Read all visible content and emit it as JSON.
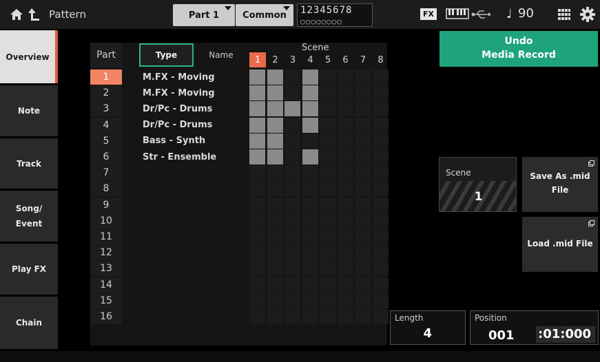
{
  "header": {
    "title": "Pattern",
    "part_button": "Part 1",
    "common_button": "Common",
    "part_numbers": "12345678",
    "part_dots": "○○○○○○○○",
    "fx_badge": "FX",
    "tempo_symbol": "♩",
    "tempo": "90"
  },
  "sidebar": {
    "items": [
      {
        "label": "Overview",
        "active": true
      },
      {
        "label": "Note",
        "active": false
      },
      {
        "label": "Track",
        "active": false
      },
      {
        "label": "Song/\nEvent",
        "active": false
      },
      {
        "label": "Play FX",
        "active": false
      },
      {
        "label": "Chain",
        "active": false
      }
    ]
  },
  "table": {
    "part_header": "Part",
    "type_tab": "Type",
    "name_tab": "Name",
    "scene_header": "Scene",
    "scene_numbers": [
      "1",
      "2",
      "3",
      "4",
      "5",
      "6",
      "7",
      "8"
    ],
    "active_scene_index": 0,
    "rows": [
      {
        "num": "1",
        "name": "M.FX - Moving",
        "cells": [
          1,
          1,
          0,
          1,
          0,
          0,
          0,
          0
        ]
      },
      {
        "num": "2",
        "name": "M.FX - Moving",
        "cells": [
          1,
          1,
          0,
          1,
          0,
          0,
          0,
          0
        ]
      },
      {
        "num": "3",
        "name": "Dr/Pc - Drums",
        "cells": [
          1,
          1,
          1,
          1,
          0,
          0,
          0,
          0
        ]
      },
      {
        "num": "4",
        "name": "Dr/Pc - Drums",
        "cells": [
          1,
          1,
          0,
          1,
          0,
          0,
          0,
          0
        ]
      },
      {
        "num": "5",
        "name": "Bass - Synth",
        "cells": [
          1,
          1,
          0,
          0,
          0,
          0,
          0,
          0
        ]
      },
      {
        "num": "6",
        "name": "Str - Ensemble",
        "cells": [
          1,
          1,
          0,
          1,
          0,
          0,
          0,
          0
        ]
      },
      {
        "num": "7",
        "name": "",
        "cells": [
          0,
          0,
          0,
          0,
          0,
          0,
          0,
          0
        ]
      },
      {
        "num": "8",
        "name": "",
        "cells": [
          0,
          0,
          0,
          0,
          0,
          0,
          0,
          0
        ]
      },
      {
        "num": "9",
        "name": "",
        "cells": [
          0,
          0,
          0,
          0,
          0,
          0,
          0,
          0
        ]
      },
      {
        "num": "10",
        "name": "",
        "cells": [
          0,
          0,
          0,
          0,
          0,
          0,
          0,
          0
        ]
      },
      {
        "num": "11",
        "name": "",
        "cells": [
          0,
          0,
          0,
          0,
          0,
          0,
          0,
          0
        ]
      },
      {
        "num": "12",
        "name": "",
        "cells": [
          0,
          0,
          0,
          0,
          0,
          0,
          0,
          0
        ]
      },
      {
        "num": "13",
        "name": "",
        "cells": [
          0,
          0,
          0,
          0,
          0,
          0,
          0,
          0
        ]
      },
      {
        "num": "14",
        "name": "",
        "cells": [
          0,
          0,
          0,
          0,
          0,
          0,
          0,
          0
        ]
      },
      {
        "num": "15",
        "name": "",
        "cells": [
          0,
          0,
          0,
          0,
          0,
          0,
          0,
          0
        ]
      },
      {
        "num": "16",
        "name": "",
        "cells": [
          0,
          0,
          0,
          0,
          0,
          0,
          0,
          0
        ]
      }
    ],
    "active_row_index": 0
  },
  "right_panel": {
    "undo_line1": "Undo",
    "undo_line2": "Media Record",
    "scene_label": "Scene",
    "scene_value": "1",
    "save_as_line1": "Save As .mid",
    "save_as_line2": "File",
    "load_label": "Load .mid File",
    "length_label": "Length",
    "length_value": "4",
    "position_label": "Position",
    "position_bar": "001",
    "position_beat": ":01:000"
  },
  "colors": {
    "accent_orange": "#ea6a4c",
    "accent_green": "#1ea37d",
    "type_tab_border": "#27b28c"
  }
}
